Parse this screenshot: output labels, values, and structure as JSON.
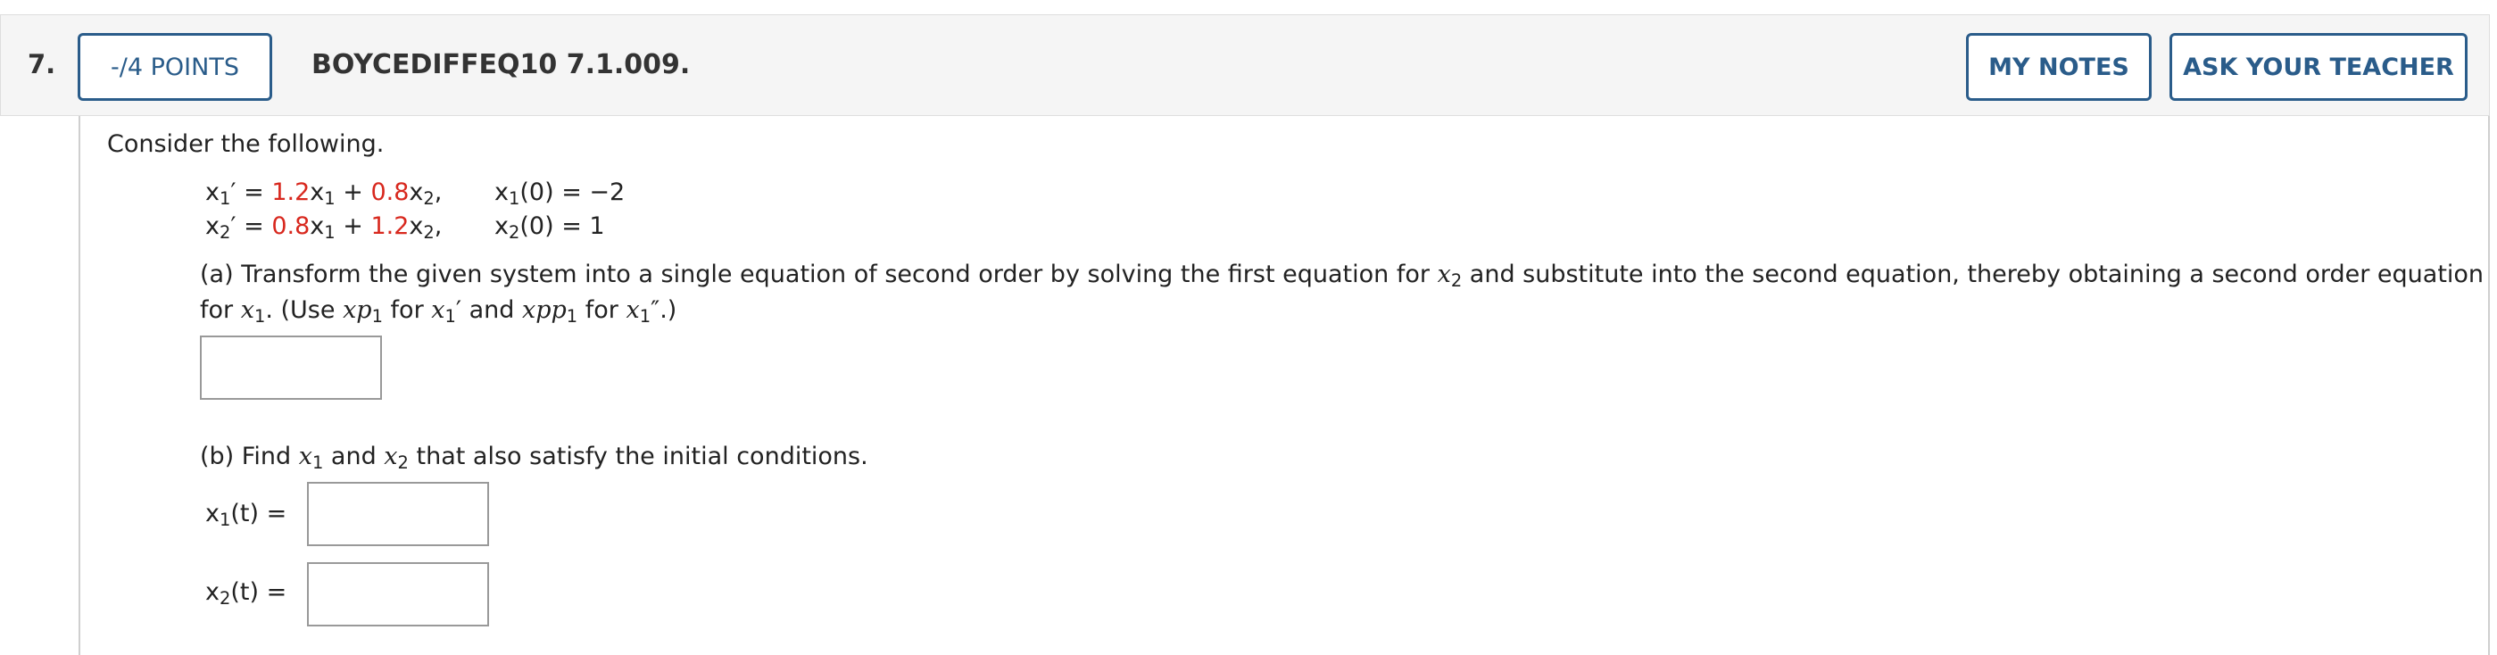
{
  "question": {
    "number": "7.",
    "points_label": "-/4 POINTS",
    "code": "BOYCEDIFFEQ10 7.1.009.",
    "my_notes_label": "MY NOTES",
    "ask_teacher_label": "ASK YOUR TEACHER"
  },
  "intro": "Consider the following.",
  "equations": {
    "eq1": {
      "lhs": "x",
      "lhs_sub": "1",
      "prime": "′",
      "equals": "=",
      "coef1": "1.2",
      "var1": "x",
      "var1_sub": "1",
      "plus": "+",
      "coef2": "0.8",
      "var2": "x",
      "var2_sub": "2",
      "comma": ",",
      "ic_var": "x",
      "ic_sub": "1",
      "ic_arg": "(0)",
      "ic_equals": "=",
      "ic_value": "−2"
    },
    "eq2": {
      "lhs": "x",
      "lhs_sub": "2",
      "prime": "′",
      "equals": "=",
      "coef1": "0.8",
      "var1": "x",
      "var1_sub": "1",
      "plus": "+",
      "coef2": "1.2",
      "var2": "x",
      "var2_sub": "2",
      "comma": ",",
      "ic_var": "x",
      "ic_sub": "2",
      "ic_arg": "(0)",
      "ic_equals": "=",
      "ic_value": "1"
    }
  },
  "part_a": {
    "line1_text": "(a) Transform the given system into a single equation of second order by solving the first equation for",
    "line1_var": "x",
    "line1_var_sub": "2",
    "line1_tail": "and substitute into the second equation, thereby obtaining a second order equation",
    "line2_for": "for",
    "line2_var": "x",
    "line2_var_sub": "1",
    "line2_use": ". (Use",
    "xp": "xp",
    "xp_sub": "1",
    "for1": "for",
    "x1p": "x",
    "x1p_sub": "1",
    "x1p_prime": "′",
    "and": "and",
    "xpp": "xpp",
    "xpp_sub": "1",
    "for2": "for",
    "x1pp": "x",
    "x1pp_sub": "1",
    "x1pp_prime": "″",
    "close": ".)",
    "answer_value": ""
  },
  "part_b": {
    "text_start": "(b) Find",
    "var1": "x",
    "var1_sub": "1",
    "and": "and",
    "var2": "x",
    "var2_sub": "2",
    "text_end": "that also satisfy the initial conditions.",
    "x1_label": "x",
    "x1_label_sub": "1",
    "x1_label_arg": "(t)",
    "x1_equals": "=",
    "x1_answer": "",
    "x2_label": "x",
    "x2_label_sub": "2",
    "x2_label_arg": "(t)",
    "x2_equals": "=",
    "x2_answer": ""
  },
  "colors": {
    "accent": "#2a5c8a",
    "highlight_red": "#d8281e"
  }
}
